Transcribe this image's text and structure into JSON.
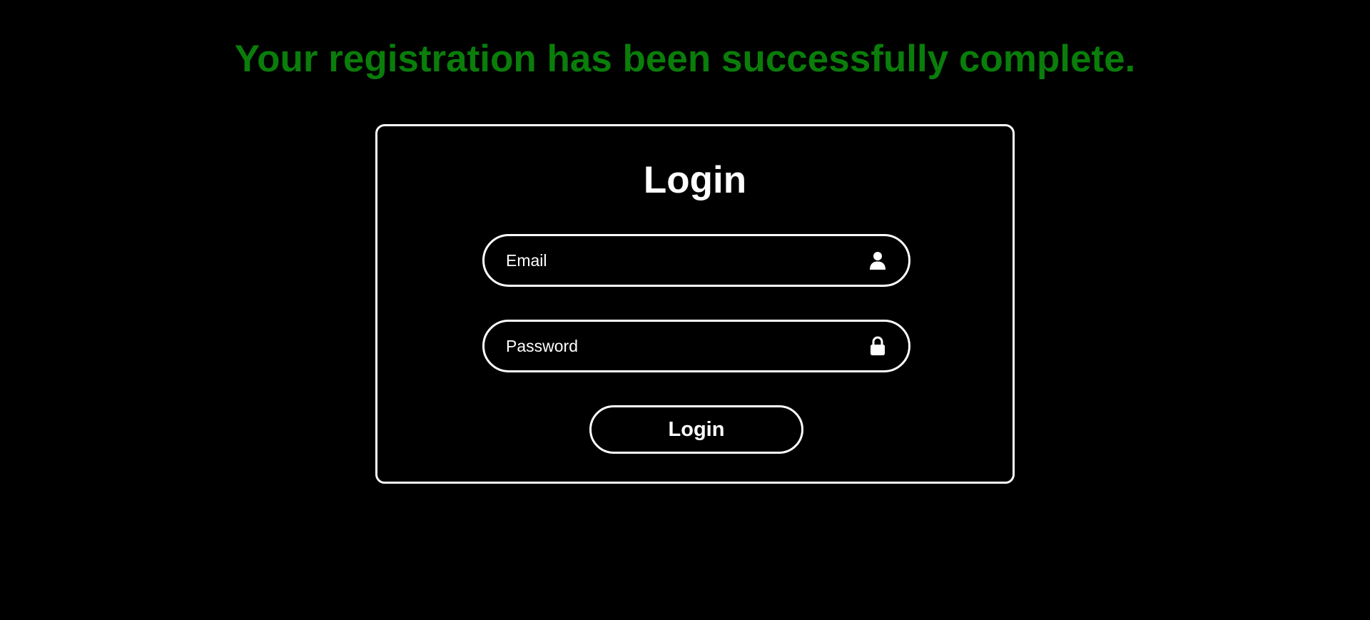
{
  "banner": {
    "message": "Your registration has been successfully complete.",
    "color": "#0a7d0a"
  },
  "login": {
    "title": "Login",
    "email": {
      "placeholder": "Email",
      "value": "",
      "icon": "user-icon"
    },
    "password": {
      "placeholder": "Password",
      "value": "",
      "icon": "lock-icon"
    },
    "submit_label": "Login"
  },
  "colors": {
    "background": "#000000",
    "foreground": "#ffffff",
    "success": "#0a7d0a"
  }
}
